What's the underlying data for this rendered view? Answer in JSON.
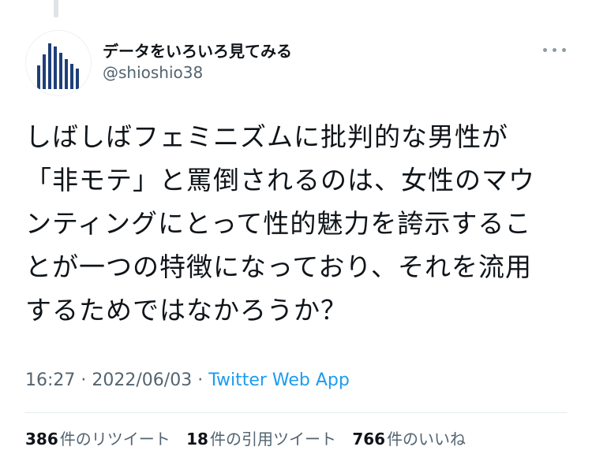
{
  "tweet": {
    "author": {
      "display_name": "データをいろいろ見てみる",
      "handle": "@shioshio38"
    },
    "text_lines": [
      "しばしばフェミニズムに批判的な男性が",
      "「非モテ」と罵倒されるのは、女性のマウ",
      "ンティングにとって性的魅力を誇示するこ",
      "とが一つの特徴になっており、それを流用",
      "するためではなかろうか？"
    ],
    "time": "16:27",
    "separator": " · ",
    "date": "2022/06/03",
    "source": "Twitter Web App",
    "stats": {
      "retweets": {
        "count": "386",
        "label": "件のリツイート"
      },
      "quotes": {
        "count": "18",
        "label": "件の引用ツイート"
      },
      "likes": {
        "count": "766",
        "label": "件のいいね"
      }
    }
  },
  "icons": {
    "avatar": "bar-chart-avatar",
    "more": "more-icon"
  },
  "colors": {
    "text": "#0f1419",
    "muted": "#536471",
    "link": "#1d9bf0",
    "avatar_bars": "#1f3f78",
    "divider": "#e6ecf0"
  }
}
